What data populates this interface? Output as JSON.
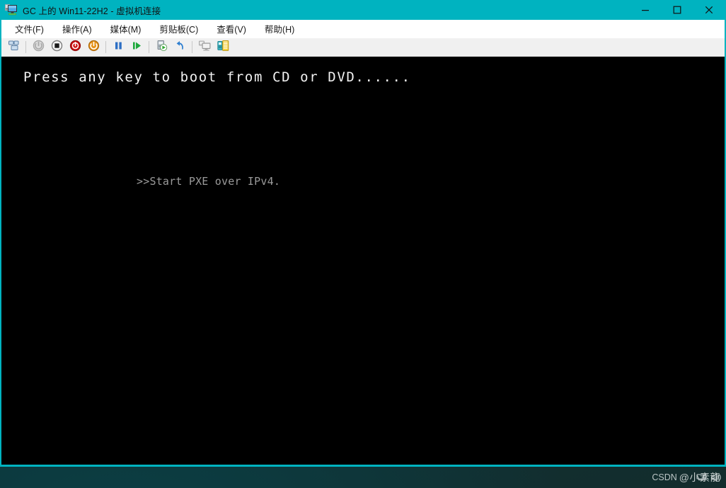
{
  "window": {
    "title": "GC 上的 Win11-22H2 - 虚拟机连接",
    "icon": "vm-connection-icon",
    "controls": {
      "minimize": "minimize-icon",
      "maximize": "maximize-icon",
      "close": "close-icon"
    },
    "frame_color": "#00b3c0"
  },
  "menubar": {
    "items": [
      {
        "label": "文件(F)",
        "name": "menu-file"
      },
      {
        "label": "操作(A)",
        "name": "menu-action"
      },
      {
        "label": "媒体(M)",
        "name": "menu-media"
      },
      {
        "label": "剪贴板(C)",
        "name": "menu-clipboard"
      },
      {
        "label": "查看(V)",
        "name": "menu-view"
      },
      {
        "label": "帮助(H)",
        "name": "menu-help"
      }
    ]
  },
  "toolbar": {
    "buttons": [
      {
        "name": "ctrl-alt-delete-icon",
        "enabled": true
      },
      {
        "name": "separator-1",
        "separator": true
      },
      {
        "name": "start-icon",
        "enabled": false
      },
      {
        "name": "turn-off-icon",
        "enabled": true
      },
      {
        "name": "shut-down-icon",
        "enabled": true
      },
      {
        "name": "reset-icon",
        "enabled": true
      },
      {
        "name": "separator-2",
        "separator": true
      },
      {
        "name": "pause-icon",
        "enabled": true
      },
      {
        "name": "resume-icon",
        "enabled": true
      },
      {
        "name": "separator-3",
        "separator": true
      },
      {
        "name": "checkpoint-icon",
        "enabled": true
      },
      {
        "name": "revert-icon",
        "enabled": true
      },
      {
        "name": "separator-4",
        "separator": true
      },
      {
        "name": "basic-session-icon",
        "enabled": false
      },
      {
        "name": "enhanced-session-icon",
        "enabled": true
      }
    ]
  },
  "console": {
    "background": "#000000",
    "boot_prompt": "Press any key to boot from CD or DVD......",
    "pxe_line": ">>Start PXE over IPv4.",
    "boot_prompt_color": "#f2f2f2",
    "pxe_line_color": "#9a9a9a"
  },
  "taskbar": {
    "watermark_brand": "CSDN",
    "watermark_handle": "@小素龍",
    "tray": [
      {
        "name": "network-tray-icon"
      },
      {
        "name": "volume-tray-icon"
      }
    ]
  }
}
